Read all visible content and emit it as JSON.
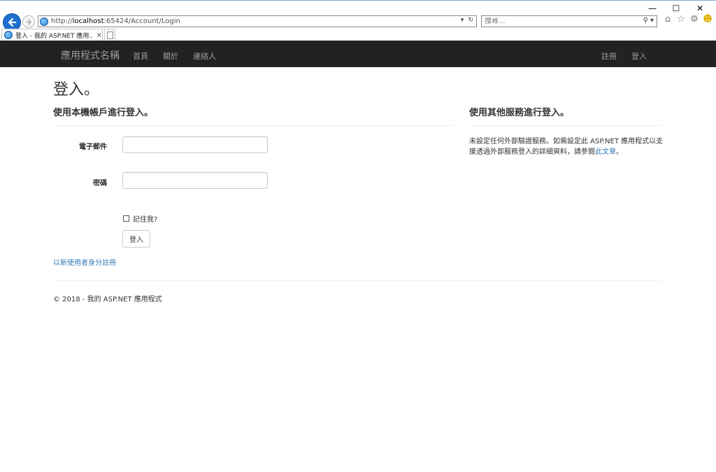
{
  "browser": {
    "address_prefix": "http://",
    "address_host": "localhost",
    "address_rest": ":65424/Account/Login",
    "search_placeholder": "搜尋...",
    "tab_title": "登入 - 我的 ASP.NET 應用...",
    "tab_close": "×",
    "window_controls": [
      "—",
      "☐",
      "✕"
    ]
  },
  "navbar": {
    "brand": "應用程式名稱",
    "links": [
      "首頁",
      "關於",
      "連絡人"
    ],
    "right_links": [
      "註冊",
      "登入"
    ]
  },
  "page": {
    "title": "登入。",
    "local_heading": "使用本機帳戶進行登入。",
    "external_heading": "使用其他服務進行登入。",
    "email_label": "電子郵件",
    "email_value": "",
    "password_label": "密碼",
    "password_value": "",
    "remember_label": "記住我?",
    "login_button": "登入",
    "register_link": "以新使用者身分註冊",
    "external_text": "未設定任何外部驗證服務。如需設定此 ASP.NET 應用程式以支援透過外部服務登入的詳細資料，請參閱",
    "external_link": "此文章",
    "external_text_end": "。"
  },
  "footer": {
    "text": "© 2018 - 我的 ASP.NET 應用程式"
  }
}
